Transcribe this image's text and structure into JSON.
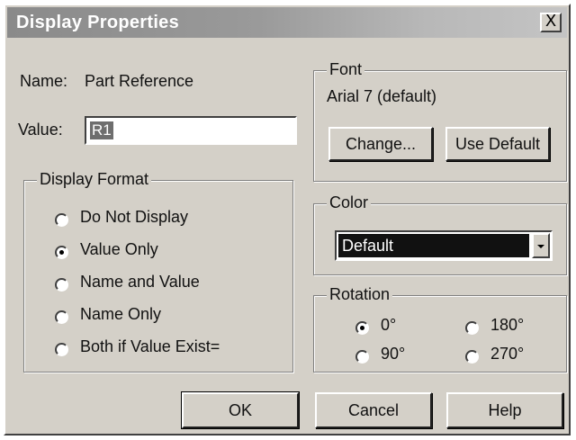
{
  "window": {
    "title": "Display Properties",
    "close_label": "X"
  },
  "name_row": {
    "label": "Name:",
    "value": "Part Reference"
  },
  "value_row": {
    "label": "Value:",
    "value": "R1"
  },
  "display_format": {
    "legend": "Display Format",
    "options": [
      "Do Not Display",
      "Value Only",
      "Name and Value",
      "Name Only",
      "Both if Value Exist="
    ],
    "selected": "Value Only"
  },
  "font": {
    "legend": "Font",
    "current": "Arial 7 (default)",
    "change_label": "Change...",
    "use_default_label": "Use Default"
  },
  "color": {
    "legend": "Color",
    "selected": "Default"
  },
  "rotation": {
    "legend": "Rotation",
    "options": [
      "0°",
      "180°",
      "90°",
      "270°"
    ],
    "selected": "0°"
  },
  "buttons": {
    "ok": "OK",
    "cancel": "Cancel",
    "help": "Help"
  },
  "colors": {
    "dialog_bg": "#d4d0c8",
    "titlebar": "#9a9a9a",
    "selection": "#111111"
  }
}
